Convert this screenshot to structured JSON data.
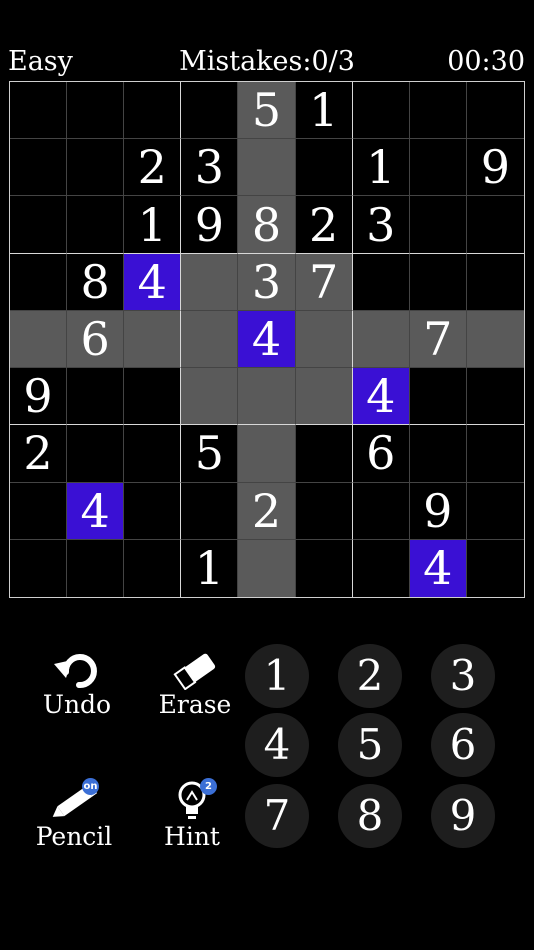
{
  "header": {
    "level": "Easy",
    "mistakes": "Mistakes:0/3",
    "timer": "00:30"
  },
  "board": {
    "rows": [
      [
        "",
        "",
        "",
        "",
        "5",
        "1",
        "",
        "",
        ""
      ],
      [
        "",
        "",
        "2",
        "3",
        "",
        "",
        "1",
        "",
        "9"
      ],
      [
        "",
        "",
        "1",
        "9",
        "8",
        "2",
        "3",
        "",
        ""
      ],
      [
        "",
        "8",
        "4",
        "",
        "3",
        "7",
        "",
        "",
        ""
      ],
      [
        "",
        "6",
        "",
        "",
        "4",
        "",
        "",
        "7",
        ""
      ],
      [
        "9",
        "",
        "",
        "",
        "",
        "",
        "4",
        "",
        ""
      ],
      [
        "2",
        "",
        "",
        "5",
        "",
        "",
        "6",
        "",
        ""
      ],
      [
        "",
        "4",
        "",
        "",
        "2",
        "",
        "",
        "9",
        ""
      ],
      [
        "",
        "",
        "",
        "1",
        "",
        "",
        "",
        "4",
        ""
      ]
    ],
    "highlight_color": "#5a5a5a",
    "selected_color": "#3a10d4",
    "selected_digit": "4",
    "selected_cell": {
      "row": 5,
      "col": 5
    }
  },
  "tools": {
    "undo": {
      "label": "Undo",
      "icon": "undo-icon"
    },
    "erase": {
      "label": "Erase",
      "icon": "eraser-icon"
    },
    "pencil": {
      "label": "Pencil",
      "icon": "pencil-icon",
      "badge": "on"
    },
    "hint": {
      "label": "Hint",
      "icon": "lightbulb-icon",
      "badge": "2"
    }
  },
  "numpad": [
    "1",
    "2",
    "3",
    "4",
    "5",
    "6",
    "7",
    "8",
    "9"
  ]
}
